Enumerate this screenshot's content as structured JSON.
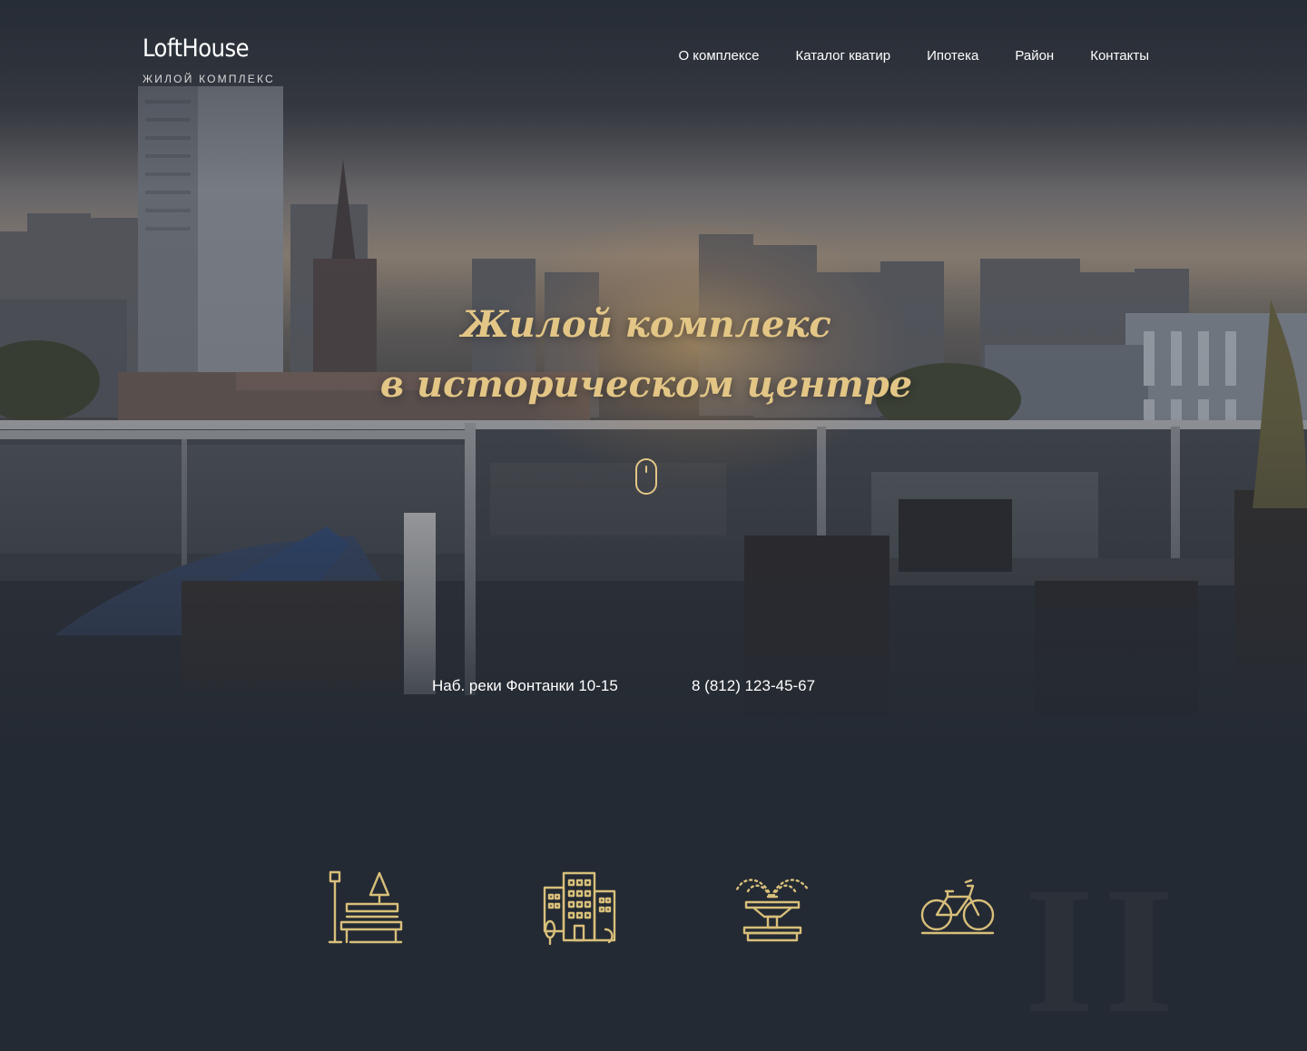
{
  "header": {
    "logo": {
      "name": "LoftHouse",
      "subtitle": "ЖИЛОЙ КОМПЛЕКС"
    },
    "nav": [
      {
        "label": "О комплексе"
      },
      {
        "label": "Каталог кватир"
      },
      {
        "label": "Ипотека"
      },
      {
        "label": "Район"
      },
      {
        "label": "Контакты"
      }
    ]
  },
  "hero": {
    "title_line1": "Жилой комплекс",
    "title_line2": "в историческом центре",
    "scroll_icon": "mouse-scroll-icon",
    "address": "Наб. реки Фонтанки 10-15",
    "phone": "8 (812) 123-45-67"
  },
  "features": {
    "icons": [
      "park-bench-icon",
      "city-buildings-icon",
      "fountain-icon",
      "bicycle-icon"
    ]
  },
  "colors": {
    "background": "#242a33",
    "accent_gold": "#e3c686",
    "icon_gold": "#d8bf7a",
    "text": "#ffffff"
  }
}
